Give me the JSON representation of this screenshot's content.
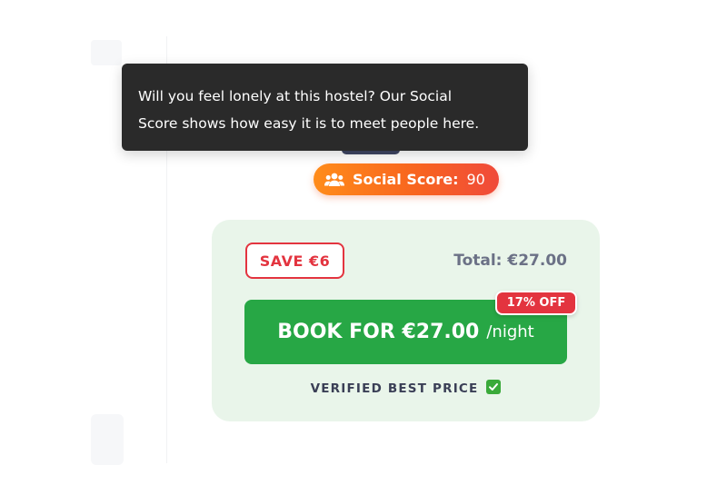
{
  "tooltip": {
    "line1": "Will you feel lonely at this hostel? Our Social",
    "line2": "Score shows how easy it is to meet people here."
  },
  "social_score": {
    "icon": "people-group-icon",
    "label": "Social Score:",
    "value": "90"
  },
  "booking": {
    "save_badge": "SAVE €6",
    "total": "Total: €27.00",
    "book_label": "BOOK FOR €27.00",
    "book_unit": "/night",
    "discount_badge": "17% OFF",
    "verified_text": "VERIFIED BEST PRICE",
    "verified_icon": "check-mark-icon"
  },
  "colors": {
    "accent_green": "#27a745",
    "card_background": "#e9f5ea",
    "badge_red": "#e3343f",
    "tooltip_background": "#2a2a2a",
    "social_gradient_start": "#ff8c1a",
    "social_gradient_end": "#f04a3a"
  }
}
